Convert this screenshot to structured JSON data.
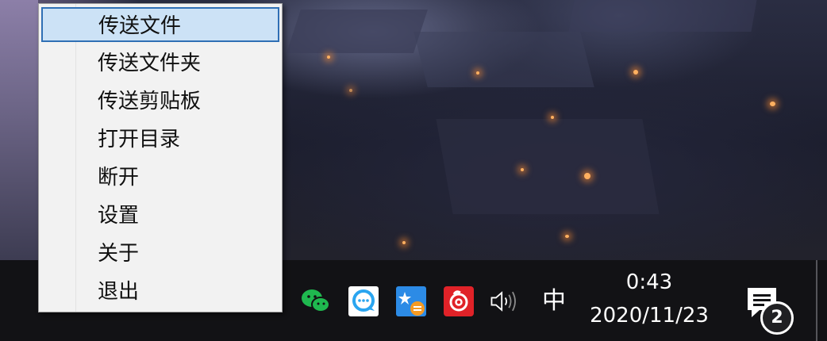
{
  "context_menu": {
    "items": [
      {
        "label": "传送文件",
        "highlighted": true
      },
      {
        "label": "传送文件夹",
        "highlighted": false
      },
      {
        "label": "传送剪贴板",
        "highlighted": false
      },
      {
        "label": "打开目录",
        "highlighted": false
      },
      {
        "label": "断开",
        "highlighted": false
      },
      {
        "label": "设置",
        "highlighted": false
      },
      {
        "label": "关于",
        "highlighted": false
      },
      {
        "label": "退出",
        "highlighted": false
      }
    ],
    "highlight_color": "#cce2f6",
    "highlight_border": "#2f6fb5"
  },
  "tray": {
    "icons": [
      "wechat-icon",
      "chat-bubble-icon",
      "star-list-icon",
      "netease-music-icon",
      "volume-icon"
    ],
    "ime_indicator": "中",
    "colors": {
      "wechat": "#1fb84f",
      "chat_bubble": "#2aa5f0",
      "star_list": "#2c8be6",
      "netease_music": "#e02228"
    }
  },
  "clock": {
    "time": "0:43",
    "date": "2020/11/23"
  },
  "notifications": {
    "count": "2"
  },
  "taskbar": {
    "background": "#121215"
  }
}
